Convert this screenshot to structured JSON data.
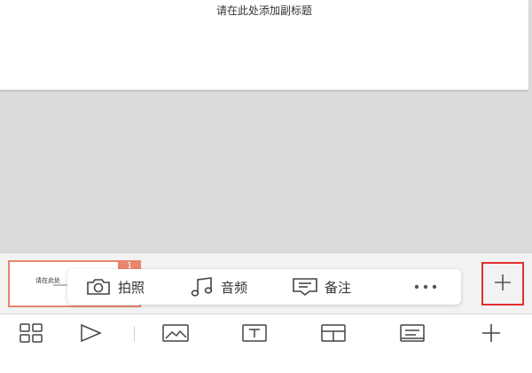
{
  "slide": {
    "subtitle_placeholder": "请在此处添加副标题"
  },
  "thumbnail": {
    "number": "1",
    "text": "请在此处"
  },
  "popup": {
    "items": [
      {
        "label": "拍照",
        "icon": "camera-icon"
      },
      {
        "label": "音频",
        "icon": "music-note-icon"
      },
      {
        "label": "备注",
        "icon": "note-icon"
      }
    ],
    "more_icon": "more-icon"
  },
  "add_slide_icon": "plus-icon",
  "bottom_toolbar": {
    "icons": [
      "grid-view-icon",
      "play-icon",
      "image-icon",
      "text-box-icon",
      "layout-icon",
      "notes-icon",
      "plus-icon"
    ]
  },
  "colors": {
    "accent": "#e8866a",
    "highlight_border": "#e03030",
    "background": "#dcdcdc"
  }
}
